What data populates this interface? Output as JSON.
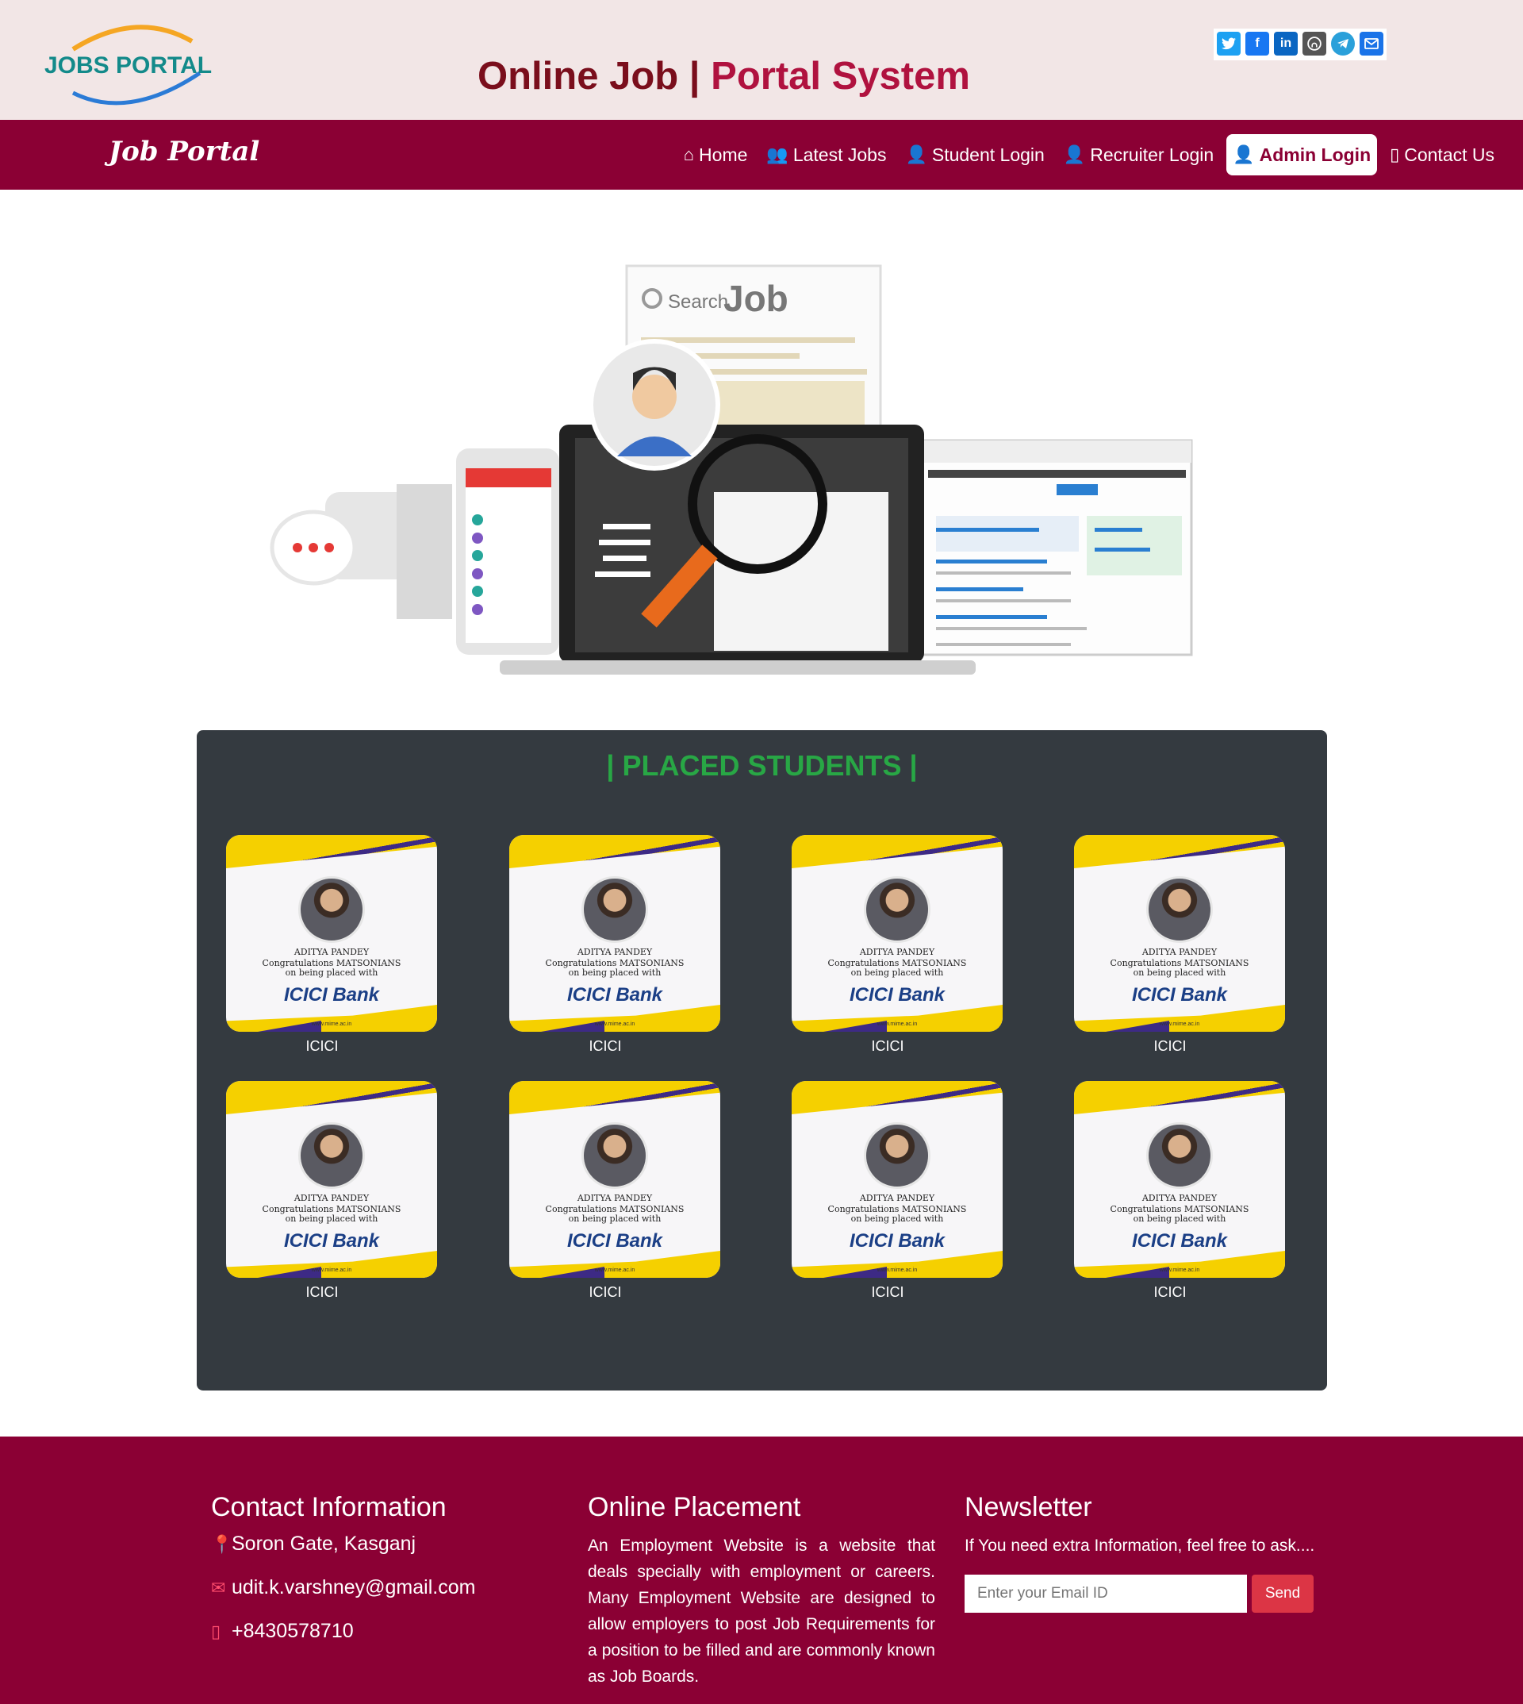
{
  "header": {
    "logo_text": "JOBS PORTAL",
    "title_part1": "Online Job |",
    "title_part2": "Portal System",
    "social_icons": [
      "twitter-icon",
      "facebook-icon",
      "linkedin-icon",
      "github-icon",
      "telegram-icon",
      "mail-icon"
    ]
  },
  "nav": {
    "brand": "Job Portal",
    "items": [
      {
        "label": "Home",
        "icon": "home-icon"
      },
      {
        "label": "Latest Jobs",
        "icon": "users-icon"
      },
      {
        "label": "Student Login",
        "icon": "user-plus-icon"
      },
      {
        "label": "Recruiter Login",
        "icon": "user-tie-icon"
      },
      {
        "label": "Admin Login",
        "icon": "user-cog-icon",
        "active": true
      },
      {
        "label": "Contact Us",
        "icon": "mobile-icon"
      }
    ]
  },
  "hero": {
    "search_label": "Search",
    "search_word": "Job"
  },
  "placed": {
    "title": "| PLACED STUDENTS |",
    "cards": [
      {
        "name": "ADITYA PANDEY",
        "line1": "Congratulations MATSONIANS",
        "line2": "on being placed with",
        "bank": "ICICI Bank",
        "site": "www.mime.ac.in",
        "label": "ICICI"
      },
      {
        "name": "ADITYA PANDEY",
        "line1": "Congratulations MATSONIANS",
        "line2": "on being placed with",
        "bank": "ICICI Bank",
        "site": "www.mime.ac.in",
        "label": "ICICI"
      },
      {
        "name": "ADITYA PANDEY",
        "line1": "Congratulations MATSONIANS",
        "line2": "on being placed with",
        "bank": "ICICI Bank",
        "site": "www.mime.ac.in",
        "label": "ICICI"
      },
      {
        "name": "ADITYA PANDEY",
        "line1": "Congratulations MATSONIANS",
        "line2": "on being placed with",
        "bank": "ICICI Bank",
        "site": "www.mime.ac.in",
        "label": "ICICI"
      },
      {
        "name": "ADITYA PANDEY",
        "line1": "Congratulations MATSONIANS",
        "line2": "on being placed with",
        "bank": "ICICI Bank",
        "site": "www.mime.ac.in",
        "label": "ICICI"
      },
      {
        "name": "ADITYA PANDEY",
        "line1": "Congratulations MATSONIANS",
        "line2": "on being placed with",
        "bank": "ICICI Bank",
        "site": "www.mime.ac.in",
        "label": "ICICI"
      },
      {
        "name": "ADITYA PANDEY",
        "line1": "Congratulations MATSONIANS",
        "line2": "on being placed with",
        "bank": "ICICI Bank",
        "site": "www.mime.ac.in",
        "label": "ICICI"
      },
      {
        "name": "ADITYA PANDEY",
        "line1": "Congratulations MATSONIANS",
        "line2": "on being placed with",
        "bank": "ICICI Bank",
        "site": "www.mime.ac.in",
        "label": "ICICI"
      }
    ]
  },
  "footer": {
    "contact": {
      "heading": "Contact Information",
      "address": "Soron Gate, Kasganj",
      "email": "udit.k.varshney@gmail.com",
      "phone": "+8430578710"
    },
    "placement": {
      "heading": "Online Placement",
      "text": "An Employment Website is a website that deals specially with employment or careers. Many Employment Website are designed to allow employers to post Job Requirements for a position to be filled and are commonly known as Job Boards."
    },
    "newsletter": {
      "heading": "Newsletter",
      "text": "If You need extra Information, feel free to ask....",
      "placeholder": "Enter your Email ID",
      "button": "Send"
    }
  },
  "colors": {
    "brand": "#8b0034",
    "header_bg": "#f2e6e6",
    "accent_green": "#28a745",
    "panel": "#343a40",
    "send": "#dc3545"
  }
}
